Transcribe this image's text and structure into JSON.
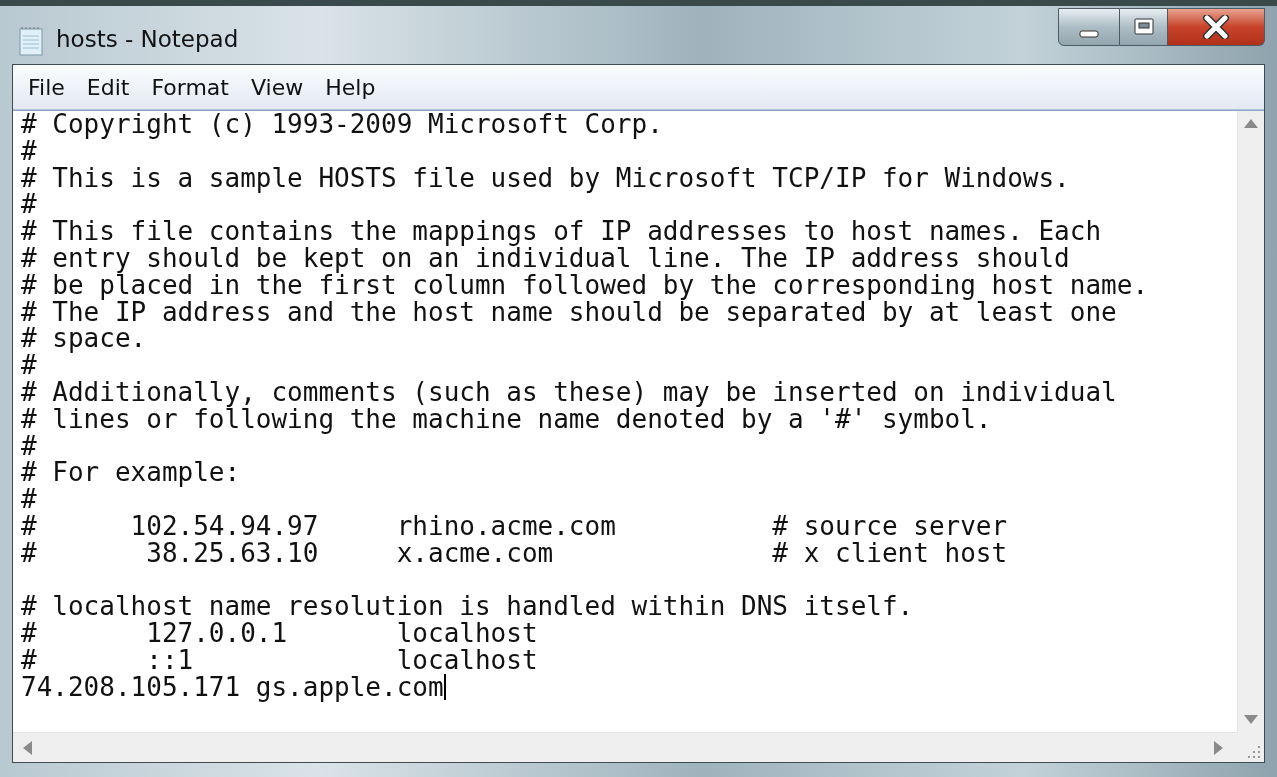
{
  "window": {
    "title": "hosts - Notepad"
  },
  "menu": [
    {
      "label": "File"
    },
    {
      "label": "Edit"
    },
    {
      "label": "Format"
    },
    {
      "label": "View"
    },
    {
      "label": "Help"
    }
  ],
  "editor": {
    "blocks": [
      [
        "# Copyright (c) 1993-2009 Microsoft Corp.",
        "#",
        "# This is a sample HOSTS file used by Microsoft TCP/IP for Windows.",
        "#",
        "# This file contains the mappings of IP addresses to host names. Each",
        "# entry should be kept on an individual line. The IP address should",
        "# be placed in the first column followed by the corresponding host name.",
        "# The IP address and the host name should be separated by at least one",
        "# space.",
        "#",
        "# Additionally, comments (such as these) may be inserted on individual",
        "# lines or following the machine name denoted by a '#' symbol.",
        "#",
        "# For example:",
        "#",
        "#      102.54.94.97     rhino.acme.com          # source server",
        "#       38.25.63.10     x.acme.com              # x client host"
      ],
      [
        "# localhost name resolution is handled within DNS itself.",
        "#       127.0.0.1       localhost",
        "#       ::1             localhost",
        "74.208.105.171 gs.apple.com"
      ]
    ]
  }
}
